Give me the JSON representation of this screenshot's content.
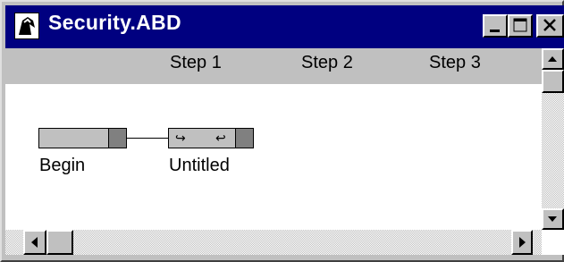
{
  "window": {
    "title": "Security.ABD",
    "controls": [
      "minimize",
      "maximize",
      "close"
    ]
  },
  "step_header": {
    "steps": [
      "Step 1",
      "Step 2",
      "Step 3"
    ]
  },
  "canvas": {
    "nodes": [
      {
        "label": "Begin",
        "kind": "start"
      },
      {
        "label": "Untitled",
        "kind": "step"
      }
    ],
    "connections": [
      [
        "Begin",
        "Untitled"
      ]
    ]
  },
  "scrollbars": {
    "vertical": {
      "up_icon": "arrow-up-icon",
      "down_icon": "arrow-down-icon"
    },
    "horizontal": {
      "left_icon": "arrow-left-icon",
      "right_icon": "arrow-right-icon"
    }
  },
  "colors": {
    "title_bar": "#000080",
    "face": "#c0c0c0",
    "canvas": "#ffffff"
  }
}
